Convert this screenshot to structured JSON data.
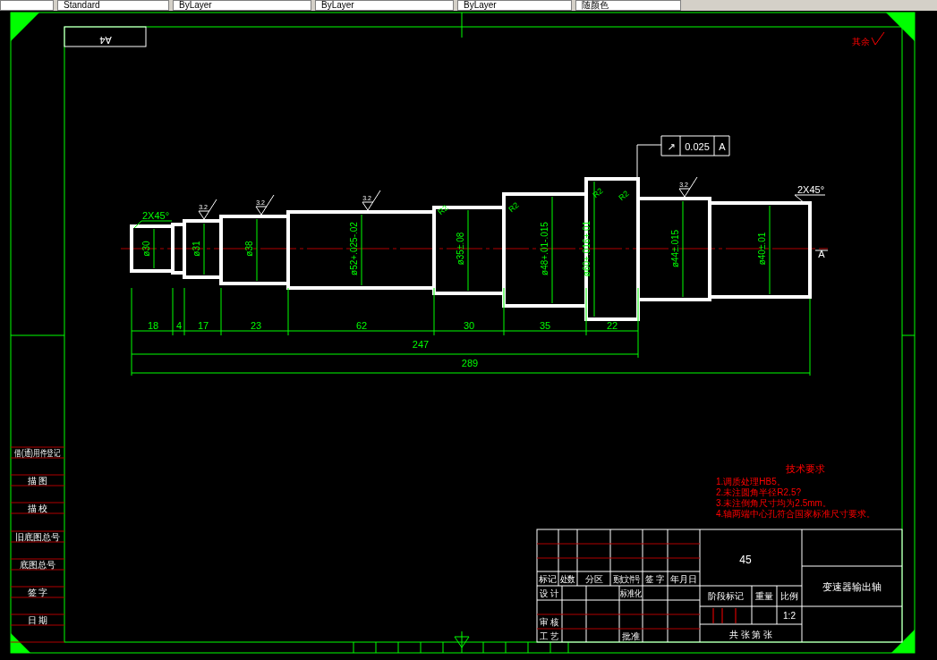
{
  "toolbar": {
    "dropdowns": [
      {
        "label": "Standard"
      },
      {
        "label": "ByLayer"
      },
      {
        "label": "ByLayer"
      },
      {
        "label": "ByLayer"
      },
      {
        "label": "随颜色"
      }
    ]
  },
  "drawing": {
    "sheet_code": "A4",
    "roughness_note": "其余",
    "chamfer_labels": [
      "2X45°",
      "2X45°"
    ],
    "roughness_marks": [
      "3.2",
      "3.2",
      "3.2",
      "3.2"
    ],
    "fillet_labels": [
      "R2",
      "R2",
      "R2",
      "R2"
    ],
    "diameter_labels": [
      "ø30",
      "ø31",
      "ø38",
      "ø52+.025-.02",
      "ø35±.08",
      "ø48+.01-.015",
      "ø60+.016+.01",
      "ø44±.015",
      "ø40±.01"
    ],
    "length_dimensions": [
      "18",
      "4",
      "17",
      "23",
      "62",
      "30",
      "35",
      "22",
      "247",
      "289"
    ],
    "tolerance_frame": {
      "symbol": "↗",
      "value": "0.025",
      "datum": "A"
    },
    "datum_label": "A"
  },
  "side_table": [
    "借(通)用件登记",
    "描 图",
    "描 校",
    "旧底图总号",
    "底图总号",
    "签 字",
    "日 期"
  ],
  "tech_requirements": {
    "title": "技术要求",
    "items": [
      "1.调质处理HB5。",
      "2.未注圆角半径R2.5?",
      "3.未注倒角尺寸均为2.5mm。",
      "4.轴两端中心孔符合国家标准尺寸要求。"
    ]
  },
  "title_block": {
    "material": "45",
    "part_name": "变速器输出轴",
    "header_labels": [
      "标记",
      "处数",
      "分区",
      "更改文件号",
      "签 字",
      "年月日"
    ],
    "row_labels": [
      "设 计",
      "标准化",
      "审 核",
      "工 艺",
      "批准"
    ],
    "stage_labels": [
      "阶段标记",
      "重量",
      "比例"
    ],
    "scale": "1:2",
    "sheet_count": "共 张 第 张"
  }
}
